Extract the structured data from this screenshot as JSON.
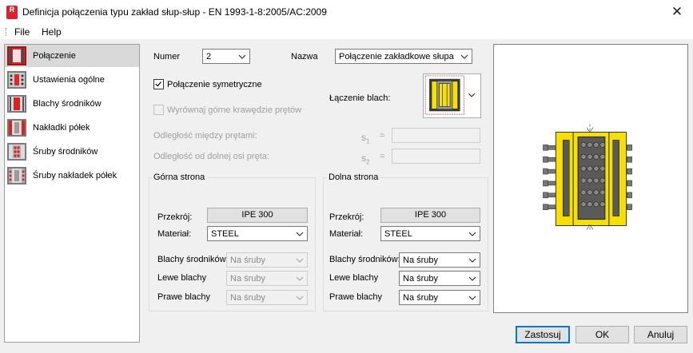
{
  "window": {
    "title": "Definicja połączenia typu zakład słup-słup - EN 1993-1-8:2005/AC:2009",
    "app_icon": "R",
    "close_glyph": "✕"
  },
  "menu": {
    "file": "File",
    "help": "Help"
  },
  "sidebar": {
    "items": [
      {
        "label": "Połączenie",
        "icon": "connection-icon"
      },
      {
        "label": "Ustawienia ogólne",
        "icon": "general-settings-icon"
      },
      {
        "label": "Blachy środników",
        "icon": "web-plates-icon"
      },
      {
        "label": "Nakładki półek",
        "icon": "flange-covers-icon"
      },
      {
        "label": "Śruby środników",
        "icon": "web-bolts-icon"
      },
      {
        "label": "Śruby nakładek półek",
        "icon": "flange-cover-bolts-icon"
      }
    ]
  },
  "form": {
    "numer_label": "Numer",
    "numer_value": "2",
    "nazwa_label": "Nazwa",
    "nazwa_value": "Połączenie zakładkowe słupa",
    "symmetric_label": "Połączenie symetryczne",
    "symmetric_checked": true,
    "align_label": "Wyrównaj górne krawędzie prętów",
    "align_checked": false,
    "plate_join_label": "Łączenie blach:",
    "dist_bars_label": "Odległość między prętami:",
    "dist_axis_label": "Odległość od dolnej osi pręta:",
    "s1": "s",
    "s1_sub": "1",
    "s2": "s",
    "s2_sub": "2",
    "equals": "="
  },
  "upper": {
    "title": "Górna strona",
    "section_label": "Przekrój:",
    "section_value": "IPE 300",
    "material_label": "Materiał:",
    "material_value": "STEEL",
    "web_plates_label": "Blachy środników:",
    "web_plates_value": "Na śruby",
    "left_plates_label": "Lewe blachy",
    "left_plates_value": "Na śruby",
    "right_plates_label": "Prawe blachy",
    "right_plates_value": "Na śruby"
  },
  "lower": {
    "title": "Dolna strona",
    "section_label": "Przekrój:",
    "section_value": "IPE 300",
    "material_label": "Materiał:",
    "material_value": "STEEL",
    "web_plates_label": "Blachy środników:",
    "web_plates_value": "Na śruby",
    "left_plates_label": "Lewe blachy",
    "left_plates_value": "Na śruby",
    "right_plates_label": "Prawe blachy",
    "right_plates_value": "Na śruby"
  },
  "buttons": {
    "apply": "Zastosuj",
    "ok": "OK",
    "cancel": "Anuluj"
  },
  "colors": {
    "accent": "#0078d7",
    "steel_yellow": "#f5e000",
    "plate_gray": "#5a5a5a",
    "brand_red": "#d9232e"
  }
}
